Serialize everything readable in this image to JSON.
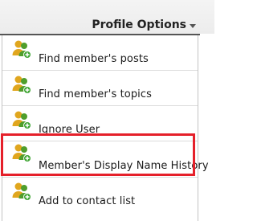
{
  "header": {
    "title": "Profile Options"
  },
  "menu": {
    "items": [
      {
        "label": "Find member's posts",
        "icon": "users-icon"
      },
      {
        "label": "Find member's topics",
        "icon": "users-icon"
      },
      {
        "label": "Ignore User",
        "icon": "users-icon"
      },
      {
        "label": "Member's Display Name History",
        "icon": "users-icon",
        "highlighted": true
      },
      {
        "label": "Add to contact list",
        "icon": "users-icon"
      }
    ]
  },
  "colors": {
    "highlight_border": "#e5202a",
    "icon_user_a": "#e0a61e",
    "icon_user_b": "#4f9e2c",
    "icon_badge": "#3fa534"
  }
}
